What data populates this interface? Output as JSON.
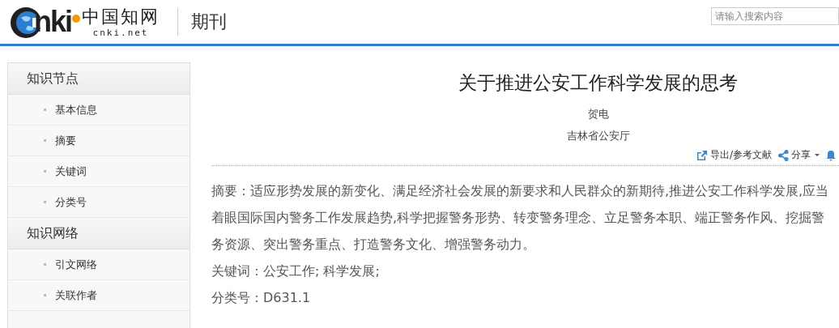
{
  "header": {
    "logo_text": "nki",
    "logo_cn": "中国知网",
    "logo_domain": "cnki.net",
    "section": "期刊",
    "search": {
      "placeholder": "请输入搜索内容"
    }
  },
  "sidebar": {
    "groups": [
      {
        "title": "知识节点",
        "items": [
          {
            "label": "基本信息"
          },
          {
            "label": "摘要"
          },
          {
            "label": "关键词"
          },
          {
            "label": "分类号"
          }
        ]
      },
      {
        "title": "知识网络",
        "items": [
          {
            "label": "引文网络"
          },
          {
            "label": "关联作者"
          }
        ]
      }
    ]
  },
  "article": {
    "title": "关于推进公安工作科学发展的思考",
    "author": "贺电",
    "affiliation": "吉林省公安厅",
    "tools": [
      {
        "kind": "export",
        "label": "导出/参考文献"
      },
      {
        "kind": "share",
        "label": "分享"
      },
      {
        "kind": "bell"
      }
    ],
    "fields": [
      {
        "label": "摘要：",
        "value": "适应形势发展的新变化、满足经济社会发展的新要求和人民群众的新期待,推进公安工作科学发展,应当着眼国际国内警务工作发展趋势,科学把握警务形势、转变警务理念、立足警务本职、端正警务作风、挖掘警务资源、突出警务重点、打造警务文化、增强警务动力。"
      },
      {
        "label": "关键词：",
        "value": "公安工作; 科学发展;"
      },
      {
        "label": "分类号：",
        "value": "D631.1"
      }
    ]
  }
}
